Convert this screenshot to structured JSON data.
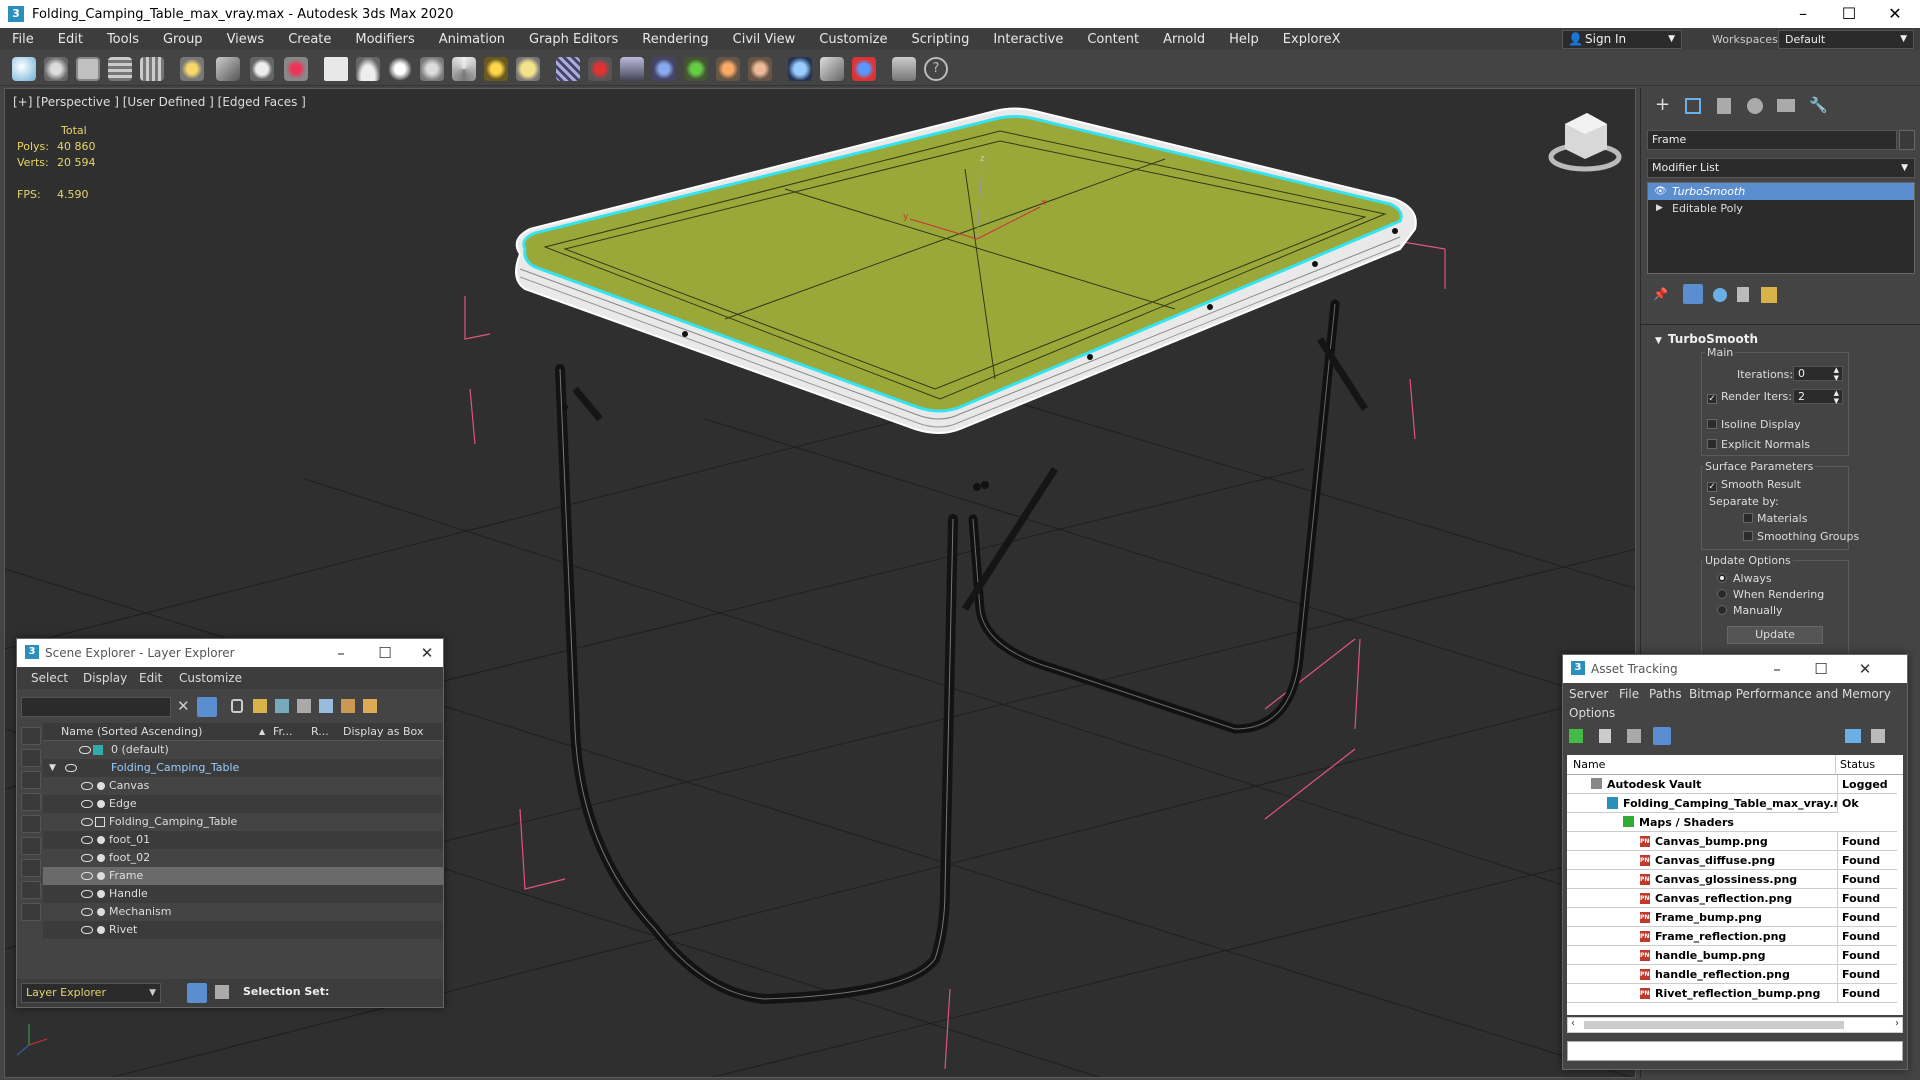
{
  "window": {
    "title": "Folding_Camping_Table_max_vray.max - Autodesk 3ds Max 2020"
  },
  "menu": [
    "File",
    "Edit",
    "Tools",
    "Group",
    "Views",
    "Create",
    "Modifiers",
    "Animation",
    "Graph Editors",
    "Rendering",
    "Civil View",
    "Customize",
    "Scripting",
    "Interactive",
    "Content",
    "Arnold",
    "Help",
    "ExploreX"
  ],
  "account": {
    "signin": "Sign In",
    "workspaces_label": "Workspaces:",
    "workspace": "Default"
  },
  "viewport": {
    "label": "[+] [Perspective ] [User Defined ] [Edged Faces ]",
    "stats": {
      "total_label": "Total",
      "polys_label": "Polys:",
      "polys": "40 860",
      "verts_label": "Verts:",
      "verts": "20 594",
      "fps_label": "FPS:",
      "fps": "4.590"
    }
  },
  "command_panel": {
    "object_name": "Frame",
    "modifier_list": "Modifier List",
    "stack": [
      "TurboSmooth",
      "Editable Poly"
    ],
    "turbosmooth": {
      "title": "TurboSmooth",
      "main": "Main",
      "iterations_label": "Iterations:",
      "iterations": "0",
      "render_iters_label": "Render Iters:",
      "render_iters": "2",
      "isoline": "Isoline Display",
      "explicit_normals": "Explicit Normals",
      "surface_params": "Surface Parameters",
      "smooth_result": "Smooth Result",
      "separate_by": "Separate by:",
      "materials": "Materials",
      "smoothing_groups": "Smoothing Groups",
      "update_options": "Update Options",
      "always": "Always",
      "when_rendering": "When Rendering",
      "manually": "Manually",
      "update_button": "Update"
    }
  },
  "scene_explorer": {
    "title": "Scene Explorer - Layer Explorer",
    "menu": [
      "Select",
      "Display",
      "Edit",
      "Customize"
    ],
    "columns": [
      "Name (Sorted Ascending)",
      "Fr...",
      "R...",
      "Display as Box"
    ],
    "rows": [
      "0 (default)",
      "Folding_Camping_Table",
      "Canvas",
      "Edge",
      "Folding_Camping_Table",
      "foot_01",
      "foot_02",
      "Frame",
      "Handle",
      "Mechanism",
      "Rivet"
    ],
    "footer_layer": "Layer Explorer",
    "footer_selection": "Selection Set:"
  },
  "asset_tracking": {
    "title": "Asset Tracking",
    "menu": [
      "Server",
      "File",
      "Paths",
      "Bitmap Performance and Memory",
      "Options"
    ],
    "columns": [
      "Name",
      "Status"
    ],
    "rows": [
      {
        "name": "Autodesk Vault",
        "status": "Logged O"
      },
      {
        "name": "Folding_Camping_Table_max_vray.max",
        "status": "Ok"
      },
      {
        "name": "Maps / Shaders",
        "status": ""
      },
      {
        "name": "Canvas_bump.png",
        "status": "Found"
      },
      {
        "name": "Canvas_diffuse.png",
        "status": "Found"
      },
      {
        "name": "Canvas_glossiness.png",
        "status": "Found"
      },
      {
        "name": "Canvas_reflection.png",
        "status": "Found"
      },
      {
        "name": "Frame_bump.png",
        "status": "Found"
      },
      {
        "name": "Frame_reflection.png",
        "status": "Found"
      },
      {
        "name": "handle_bump.png",
        "status": "Found"
      },
      {
        "name": "handle_reflection.png",
        "status": "Found"
      },
      {
        "name": "Rivet_reflection_bump.png",
        "status": "Found"
      }
    ]
  },
  "colors": {
    "table_top": "#9aa83a",
    "selection": "#35e3f0",
    "accent": "#5b8ecf"
  }
}
